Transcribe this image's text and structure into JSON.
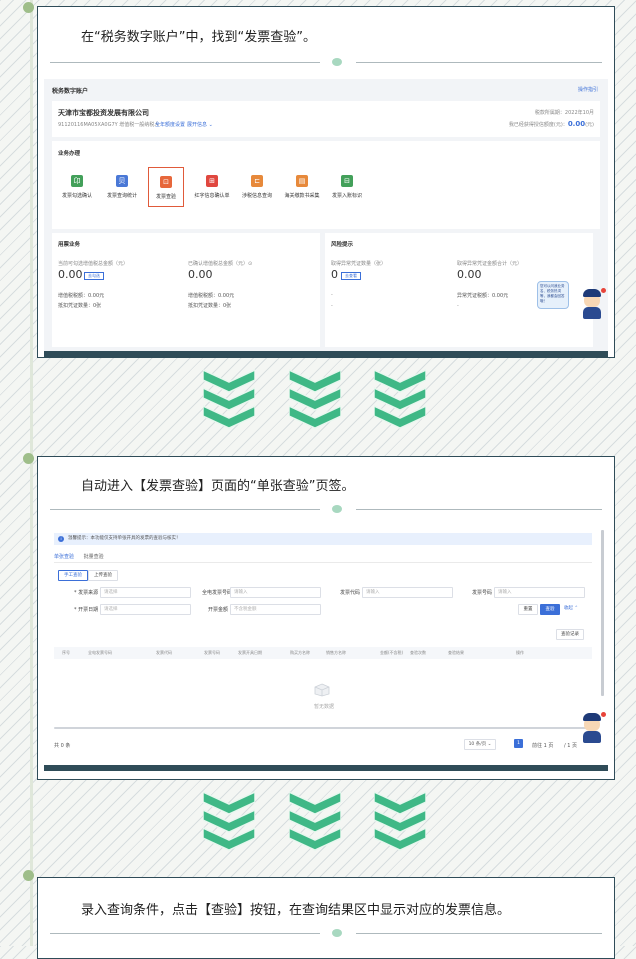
{
  "colors": {
    "accent": "#3b6fd8",
    "step_border": "#2f4c58",
    "chevron": "#3fb886",
    "active_border": "#e05a3a"
  },
  "steps": [
    {
      "instruction": "在“税务数字账户”中，找到“发票查验”。"
    },
    {
      "instruction": "自动进入【发票查验】页面的“单张查验”页签。"
    },
    {
      "instruction": "录入查询条件，点击【查验】按钮，在查询结果区中显示对应的发票信息。"
    }
  ],
  "s1": {
    "page_title": "税务数字账户",
    "top_link": "操作指引",
    "company": "天津市宝都投资发展有限公司",
    "taxid": "91120116MA05XA0G7Y 增值税一般纳税人",
    "tag1": "全年额度设置",
    "tag2": "展开信息 ⌄",
    "period": "税款所属期：2022年10月",
    "credit_label": "我已经获得授信额度(元)：",
    "credit_value": "0.00",
    "credit_unit": "(元)",
    "section": "业务办理",
    "functions": [
      {
        "label": "发票勾选确认",
        "icon": "卬",
        "color": "#43a05a",
        "icon_name": "invoice-select-icon"
      },
      {
        "label": "发票查询统计",
        "icon": "贝",
        "color": "#4a78d6",
        "icon_name": "invoice-stats-icon"
      },
      {
        "label": "发票查验",
        "icon": "⊡",
        "color": "#e7673b",
        "icon_name": "invoice-verify-icon"
      },
      {
        "label": "红字信息确认单",
        "icon": "⊞",
        "color": "#e0473f",
        "icon_name": "red-letter-icon"
      },
      {
        "label": "涉税信息查询",
        "icon": "⊏",
        "color": "#e7893b",
        "icon_name": "tax-info-icon"
      },
      {
        "label": "海关缴款书采集",
        "icon": "▤",
        "color": "#e7893b",
        "icon_name": "customs-icon"
      },
      {
        "label": "发票入账标识",
        "icon": "⊟",
        "color": "#43a05a",
        "icon_name": "invoice-account-icon"
      }
    ],
    "usage_title": "用票业务",
    "usage_col1_label": "当前可勾选增值税总金额（元）",
    "usage_col1_value": "0.00",
    "usage_col1_tag": "去勾选",
    "usage_col2_label": "已确认增值税总金额（元）⊙",
    "usage_col2_value": "0.00",
    "usage_rows": [
      "增值税税额：0.00元",
      "抵扣凭证数量：0张"
    ],
    "usage_rows2": [
      "增值税税额：0.00元",
      "抵扣凭证数量：0张"
    ],
    "risk_title": "风险提示",
    "risk_col1_label": "取得异常凭证数量（张）",
    "risk_col1_value": "0",
    "risk_col1_tag": "去查看",
    "risk_col2_label": "取得异常凭证金额合计（元）",
    "risk_col2_value": "0.00",
    "risk_row": "异常凭证税额：0.00元",
    "dash": "-",
    "bubble": "您可以问我业务名、税务热词等，我都会回答哦！"
  },
  "s2": {
    "notice": "温馨提示：本功能仅支持单张开具的发票的查验与核实！",
    "tabs": [
      "单张查验",
      "批量查验"
    ],
    "mode_tabs": [
      "手工查验",
      "上传查验"
    ],
    "f_source": "* 发票来源",
    "f_source_ph": "请选择",
    "f_fullnum": "全电发票号码",
    "f_fullnum_ph": "请输入",
    "f_code": "发票代码",
    "f_code_ph": "请输入",
    "f_num": "发票号码",
    "f_num_ph": "请输入",
    "f_date": "* 开票日期",
    "f_date_ph": "请选择",
    "f_amount": "开票金额",
    "f_amount_ph": "不含税金额",
    "btn_reset": "重置",
    "btn_query": "查验",
    "btn_collapse": "收起 ⌃",
    "btn_export": "查验记录",
    "columns": [
      "序号",
      "全电发票号码",
      "发票代码",
      "发票号码",
      "发票开具日期",
      "购买方名称",
      "销售方名称",
      "金额(不含税)",
      "查验次数",
      "查验结果",
      "操作"
    ],
    "empty": "暂无数据",
    "total": "共 0 条",
    "page_size": "10 条/页 ⌄",
    "page_num": "1",
    "goto": "前往 1 页",
    "pages": "/ 1 页"
  }
}
